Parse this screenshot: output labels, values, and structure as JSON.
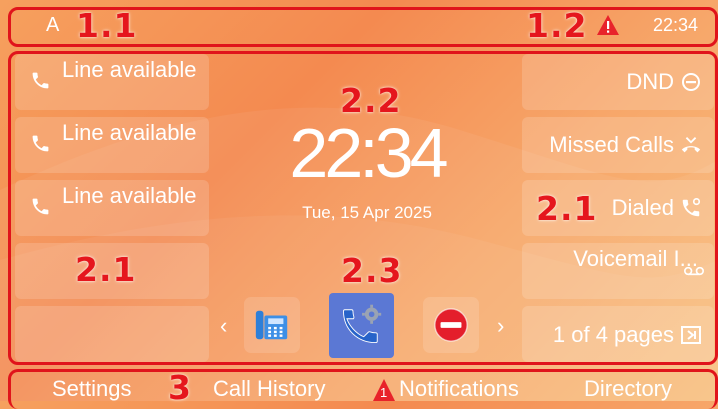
{
  "status_bar": {
    "account": "A",
    "time": "22:34",
    "alert_icon": "warning-icon"
  },
  "line_keys": [
    {
      "label": "Line available",
      "icon": "phone-icon"
    },
    {
      "label": "Line available",
      "icon": "phone-icon"
    },
    {
      "label": "Line available",
      "icon": "phone-icon"
    },
    {
      "label": "",
      "icon": ""
    },
    {
      "label": "",
      "icon": ""
    }
  ],
  "right_keys": [
    {
      "label": "DND",
      "icon": "dnd-icon"
    },
    {
      "label": "Missed Calls",
      "icon": "missed-call-icon"
    },
    {
      "label": "Dialed",
      "icon": "dialed-call-icon"
    },
    {
      "label": "Voicemail I...",
      "icon": "voicemail-icon"
    },
    {
      "label": "1 of 4 pages",
      "icon": "page-switch-icon"
    }
  ],
  "clock": {
    "time": "22:34",
    "date": "Tue, 15 Apr 2025"
  },
  "apps": [
    {
      "name": "desk-phone-app-icon",
      "selected": false
    },
    {
      "name": "call-settings-app-icon",
      "selected": true
    },
    {
      "name": "dnd-app-icon",
      "selected": false
    }
  ],
  "softkeys": {
    "settings": "Settings",
    "call_history": "Call History",
    "notifications": "Notifications",
    "notifications_badge": "1",
    "directory": "Directory"
  },
  "annotations": {
    "a11": "1.1",
    "a12": "1.2",
    "a21_left": "2.1",
    "a21_right": "2.1",
    "a22": "2.2",
    "a23": "2.3",
    "a3": "3"
  },
  "colors": {
    "annotation_red": "#e5161d",
    "selected_app_bg": "#5b78d4"
  }
}
